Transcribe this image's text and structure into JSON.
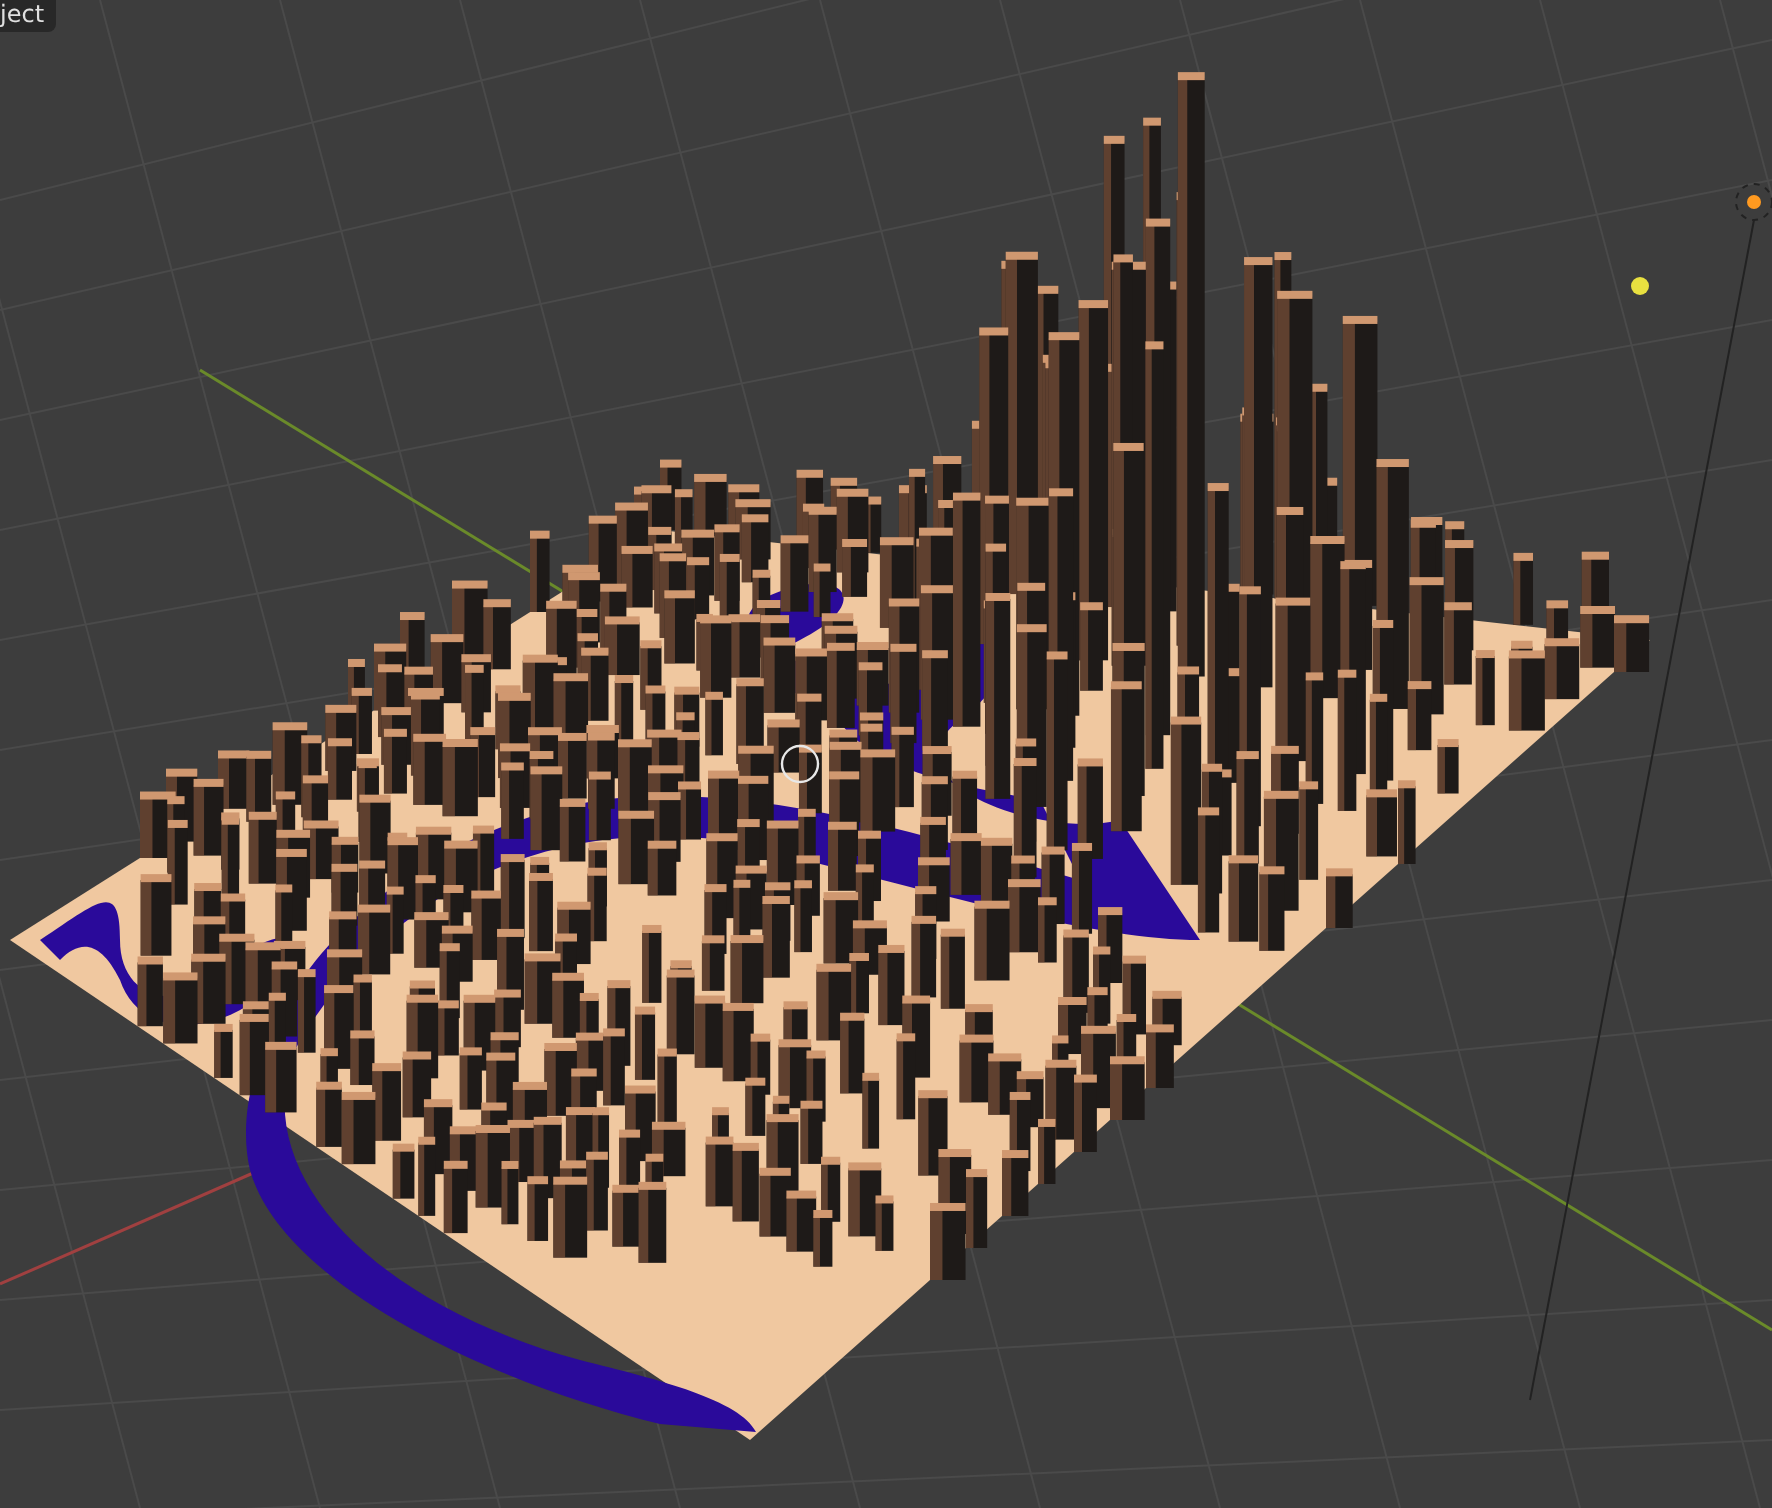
{
  "viewport": {
    "mode_label": "ject"
  }
}
